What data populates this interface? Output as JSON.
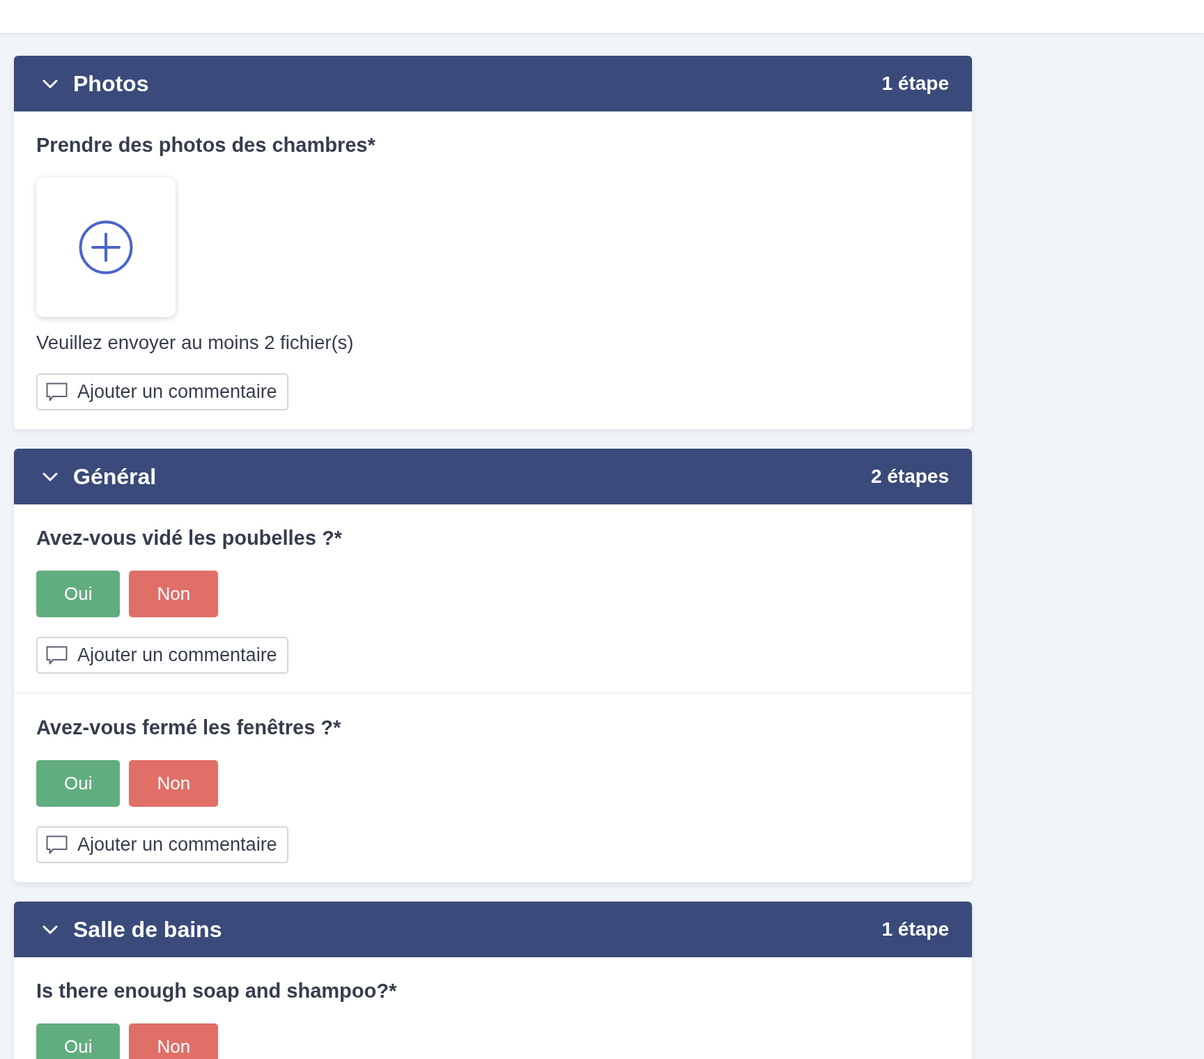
{
  "sections": [
    {
      "title": "Photos",
      "step_count": "1 étape",
      "expanded": true,
      "items": [
        {
          "kind": "photo_upload",
          "question": "Prendre des photos des chambres*",
          "hint": "Veuillez envoyer au moins 2 fichier(s)",
          "comment_button": "Ajouter un commentaire"
        }
      ]
    },
    {
      "title": "Général",
      "step_count": "2 étapes",
      "expanded": true,
      "items": [
        {
          "kind": "yes_no",
          "question": "Avez-vous vidé les poubelles ?*",
          "answers": [
            {
              "label": "Oui",
              "color": "#62ad7f"
            },
            {
              "label": "Non",
              "color": "#e06f68"
            }
          ],
          "comment_button": "Ajouter un commentaire"
        },
        {
          "kind": "yes_no",
          "question": "Avez-vous fermé les fenêtres ?*",
          "answers": [
            {
              "label": "Oui",
              "color": "#62ad7f"
            },
            {
              "label": "Non",
              "color": "#e06f68"
            }
          ],
          "comment_button": "Ajouter un commentaire"
        }
      ]
    },
    {
      "title": "Salle de bains",
      "step_count": "1 étape",
      "expanded": true,
      "items": [
        {
          "kind": "yes_no",
          "question": "Is there enough soap and shampoo?*",
          "answers": [
            {
              "label": "Oui",
              "color": "#62ad7f"
            },
            {
              "label": "Non",
              "color": "#e06f68"
            }
          ]
        }
      ]
    }
  ]
}
